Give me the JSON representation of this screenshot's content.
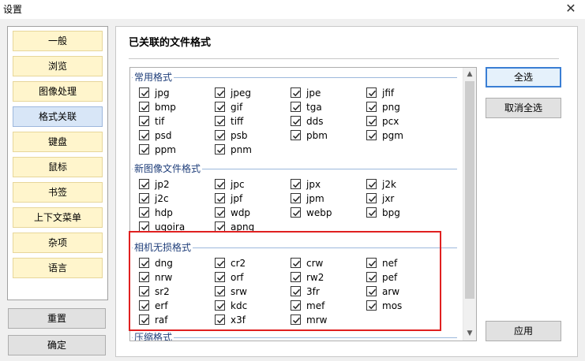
{
  "window": {
    "title": "设置",
    "close_label": "✕"
  },
  "nav": {
    "items": [
      {
        "label": "一般"
      },
      {
        "label": "浏览"
      },
      {
        "label": "图像处理"
      },
      {
        "label": "格式关联",
        "active": true
      },
      {
        "label": "键盘"
      },
      {
        "label": "鼠标"
      },
      {
        "label": "书签"
      },
      {
        "label": "上下文菜单"
      },
      {
        "label": "杂项"
      },
      {
        "label": "语言"
      }
    ],
    "reset_label": "重置",
    "ok_label": "确定"
  },
  "main": {
    "title": "已关联的文件格式",
    "select_all_label": "全选",
    "deselect_all_label": "取消全选",
    "apply_label": "应用",
    "groups": [
      {
        "name": "常用格式",
        "formats": [
          "jpg",
          "jpeg",
          "jpe",
          "jfif",
          "bmp",
          "gif",
          "tga",
          "png",
          "tif",
          "tiff",
          "dds",
          "pcx",
          "psd",
          "psb",
          "pbm",
          "pgm",
          "ppm",
          "pnm"
        ]
      },
      {
        "name": "新图像文件格式",
        "formats": [
          "jp2",
          "jpc",
          "jpx",
          "j2k",
          "j2c",
          "jpf",
          "jpm",
          "jxr",
          "hdp",
          "wdp",
          "webp",
          "bpg",
          "ugoira",
          "apng"
        ]
      },
      {
        "name": "相机无损格式",
        "formats": [
          "dng",
          "cr2",
          "crw",
          "nef",
          "nrw",
          "orf",
          "rw2",
          "pef",
          "sr2",
          "srw",
          "3fr",
          "arw",
          "erf",
          "kdc",
          "mef",
          "mos",
          "raf",
          "x3f",
          "mrw"
        ]
      },
      {
        "name": "压缩格式",
        "formats": []
      }
    ]
  },
  "colors": {
    "highlight_box": "#e02020",
    "nav_button": "#fff5cc",
    "nav_active": "#d8e6f7"
  }
}
